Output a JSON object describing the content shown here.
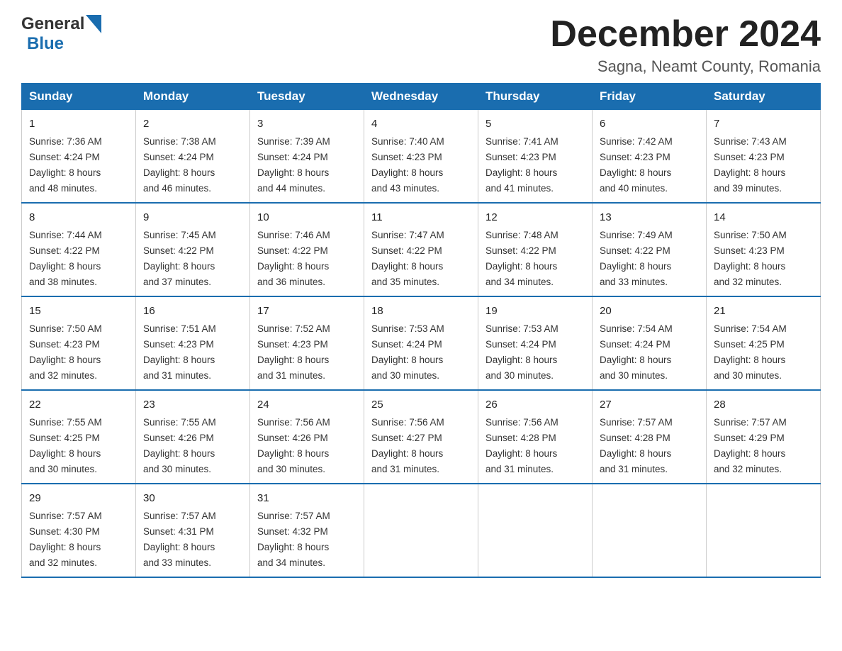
{
  "header": {
    "logo_general": "General",
    "logo_blue": "Blue",
    "month_title": "December 2024",
    "location": "Sagna, Neamt County, Romania"
  },
  "weekdays": [
    "Sunday",
    "Monday",
    "Tuesday",
    "Wednesday",
    "Thursday",
    "Friday",
    "Saturday"
  ],
  "weeks": [
    [
      {
        "day": "1",
        "sunrise": "7:36 AM",
        "sunset": "4:24 PM",
        "daylight": "8 hours and 48 minutes."
      },
      {
        "day": "2",
        "sunrise": "7:38 AM",
        "sunset": "4:24 PM",
        "daylight": "8 hours and 46 minutes."
      },
      {
        "day": "3",
        "sunrise": "7:39 AM",
        "sunset": "4:24 PM",
        "daylight": "8 hours and 44 minutes."
      },
      {
        "day": "4",
        "sunrise": "7:40 AM",
        "sunset": "4:23 PM",
        "daylight": "8 hours and 43 minutes."
      },
      {
        "day": "5",
        "sunrise": "7:41 AM",
        "sunset": "4:23 PM",
        "daylight": "8 hours and 41 minutes."
      },
      {
        "day": "6",
        "sunrise": "7:42 AM",
        "sunset": "4:23 PM",
        "daylight": "8 hours and 40 minutes."
      },
      {
        "day": "7",
        "sunrise": "7:43 AM",
        "sunset": "4:23 PM",
        "daylight": "8 hours and 39 minutes."
      }
    ],
    [
      {
        "day": "8",
        "sunrise": "7:44 AM",
        "sunset": "4:22 PM",
        "daylight": "8 hours and 38 minutes."
      },
      {
        "day": "9",
        "sunrise": "7:45 AM",
        "sunset": "4:22 PM",
        "daylight": "8 hours and 37 minutes."
      },
      {
        "day": "10",
        "sunrise": "7:46 AM",
        "sunset": "4:22 PM",
        "daylight": "8 hours and 36 minutes."
      },
      {
        "day": "11",
        "sunrise": "7:47 AM",
        "sunset": "4:22 PM",
        "daylight": "8 hours and 35 minutes."
      },
      {
        "day": "12",
        "sunrise": "7:48 AM",
        "sunset": "4:22 PM",
        "daylight": "8 hours and 34 minutes."
      },
      {
        "day": "13",
        "sunrise": "7:49 AM",
        "sunset": "4:22 PM",
        "daylight": "8 hours and 33 minutes."
      },
      {
        "day": "14",
        "sunrise": "7:50 AM",
        "sunset": "4:23 PM",
        "daylight": "8 hours and 32 minutes."
      }
    ],
    [
      {
        "day": "15",
        "sunrise": "7:50 AM",
        "sunset": "4:23 PM",
        "daylight": "8 hours and 32 minutes."
      },
      {
        "day": "16",
        "sunrise": "7:51 AM",
        "sunset": "4:23 PM",
        "daylight": "8 hours and 31 minutes."
      },
      {
        "day": "17",
        "sunrise": "7:52 AM",
        "sunset": "4:23 PM",
        "daylight": "8 hours and 31 minutes."
      },
      {
        "day": "18",
        "sunrise": "7:53 AM",
        "sunset": "4:24 PM",
        "daylight": "8 hours and 30 minutes."
      },
      {
        "day": "19",
        "sunrise": "7:53 AM",
        "sunset": "4:24 PM",
        "daylight": "8 hours and 30 minutes."
      },
      {
        "day": "20",
        "sunrise": "7:54 AM",
        "sunset": "4:24 PM",
        "daylight": "8 hours and 30 minutes."
      },
      {
        "day": "21",
        "sunrise": "7:54 AM",
        "sunset": "4:25 PM",
        "daylight": "8 hours and 30 minutes."
      }
    ],
    [
      {
        "day": "22",
        "sunrise": "7:55 AM",
        "sunset": "4:25 PM",
        "daylight": "8 hours and 30 minutes."
      },
      {
        "day": "23",
        "sunrise": "7:55 AM",
        "sunset": "4:26 PM",
        "daylight": "8 hours and 30 minutes."
      },
      {
        "day": "24",
        "sunrise": "7:56 AM",
        "sunset": "4:26 PM",
        "daylight": "8 hours and 30 minutes."
      },
      {
        "day": "25",
        "sunrise": "7:56 AM",
        "sunset": "4:27 PM",
        "daylight": "8 hours and 31 minutes."
      },
      {
        "day": "26",
        "sunrise": "7:56 AM",
        "sunset": "4:28 PM",
        "daylight": "8 hours and 31 minutes."
      },
      {
        "day": "27",
        "sunrise": "7:57 AM",
        "sunset": "4:28 PM",
        "daylight": "8 hours and 31 minutes."
      },
      {
        "day": "28",
        "sunrise": "7:57 AM",
        "sunset": "4:29 PM",
        "daylight": "8 hours and 32 minutes."
      }
    ],
    [
      {
        "day": "29",
        "sunrise": "7:57 AM",
        "sunset": "4:30 PM",
        "daylight": "8 hours and 32 minutes."
      },
      {
        "day": "30",
        "sunrise": "7:57 AM",
        "sunset": "4:31 PM",
        "daylight": "8 hours and 33 minutes."
      },
      {
        "day": "31",
        "sunrise": "7:57 AM",
        "sunset": "4:32 PM",
        "daylight": "8 hours and 34 minutes."
      },
      null,
      null,
      null,
      null
    ]
  ],
  "labels": {
    "sunrise": "Sunrise:",
    "sunset": "Sunset:",
    "daylight": "Daylight:"
  }
}
